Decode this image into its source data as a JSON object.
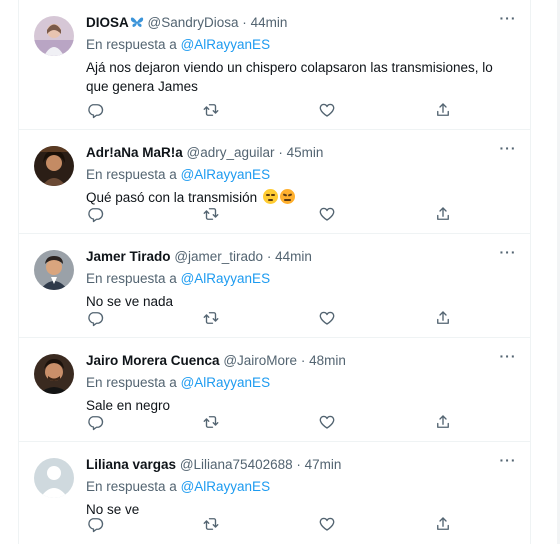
{
  "reply_prefix": "En respuesta a",
  "mention": "@AlRayyanES",
  "tweets": [
    {
      "name": "DIOSA",
      "handle": "@SandryDiosa",
      "time": "44min",
      "text": "Ajá nos dejaron viendo un chispero colapsaron las transmisiones, lo que genera James",
      "name_icon": "butterfly-emoji"
    },
    {
      "name": "Adr!aNa MaR!a",
      "handle": "@adry_aguilar",
      "time": "45min",
      "text": "Qué pasó con la transmisión",
      "text_emoji": [
        "smirk-emoji",
        "persevere-emoji"
      ]
    },
    {
      "name": "Jamer Tirado",
      "handle": "@jamer_tirado",
      "time": "44min",
      "text": "No se ve nada"
    },
    {
      "name": "Jairo Morera Cuenca",
      "handle": "@JairoMore",
      "time": "48min",
      "text": "Sale en negro"
    },
    {
      "name": "Liliana vargas",
      "handle": "@Liliana75402688",
      "time": "47min",
      "text": "No se ve"
    }
  ],
  "colors": {
    "accent": "#1d9bf0",
    "secondary_text": "#536471",
    "primary_text": "#0f1419",
    "border": "#eff3f4"
  }
}
